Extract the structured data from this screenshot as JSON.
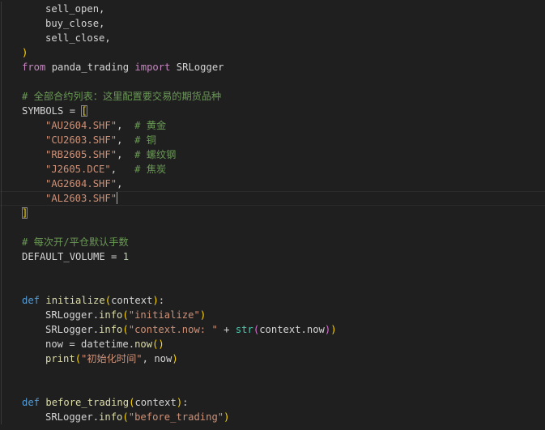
{
  "editor": {
    "language": "python",
    "lines": [
      {
        "indent": 1,
        "tokens": [
          {
            "t": "sell_open,",
            "c": "id"
          }
        ]
      },
      {
        "indent": 1,
        "tokens": [
          {
            "t": "buy_close,",
            "c": "id"
          }
        ]
      },
      {
        "indent": 1,
        "tokens": [
          {
            "t": "sell_close,",
            "c": "id"
          }
        ]
      },
      {
        "indent": 0,
        "tokens": [
          {
            "t": ")",
            "c": "br1"
          }
        ]
      },
      {
        "indent": 0,
        "tokens": [
          {
            "t": "from",
            "c": "imp"
          },
          {
            "t": " panda_trading ",
            "c": "id"
          },
          {
            "t": "import",
            "c": "imp"
          },
          {
            "t": " SRLogger",
            "c": "id"
          }
        ]
      },
      {
        "indent": 0,
        "tokens": []
      },
      {
        "indent": 0,
        "tokens": [
          {
            "t": "# 全部合约列表：这里配置要交易的期货品种",
            "c": "cm"
          }
        ]
      },
      {
        "indent": 0,
        "tokens": [
          {
            "t": "SYMBOLS = ",
            "c": "id"
          },
          {
            "t": "[",
            "c": "br1",
            "match": true
          }
        ]
      },
      {
        "indent": 1,
        "tokens": [
          {
            "t": "\"AU2604.SHF\"",
            "c": "str"
          },
          {
            "t": ",  ",
            "c": "op"
          },
          {
            "t": "# 黄金",
            "c": "cm"
          }
        ]
      },
      {
        "indent": 1,
        "tokens": [
          {
            "t": "\"CU2603.SHF\"",
            "c": "str"
          },
          {
            "t": ",  ",
            "c": "op"
          },
          {
            "t": "# 铜",
            "c": "cm"
          }
        ]
      },
      {
        "indent": 1,
        "tokens": [
          {
            "t": "\"RB2605.SHF\"",
            "c": "str"
          },
          {
            "t": ",  ",
            "c": "op"
          },
          {
            "t": "# 螺纹钢",
            "c": "cm"
          }
        ]
      },
      {
        "indent": 1,
        "tokens": [
          {
            "t": "\"J2605.DCE\"",
            "c": "str"
          },
          {
            "t": ",   ",
            "c": "op"
          },
          {
            "t": "# 焦炭",
            "c": "cm"
          }
        ]
      },
      {
        "indent": 1,
        "tokens": [
          {
            "t": "\"AG2604.SHF\"",
            "c": "str"
          },
          {
            "t": ",",
            "c": "op"
          }
        ]
      },
      {
        "indent": 1,
        "tokens": [
          {
            "t": "\"AL2603.SHF\"",
            "c": "str"
          }
        ],
        "cursor": true
      },
      {
        "indent": 0,
        "tokens": [
          {
            "t": "]",
            "c": "br1",
            "match": true
          }
        ]
      },
      {
        "indent": 0,
        "tokens": []
      },
      {
        "indent": 0,
        "tokens": [
          {
            "t": "# 每次开/平仓默认手数",
            "c": "cm"
          }
        ]
      },
      {
        "indent": 0,
        "tokens": [
          {
            "t": "DEFAULT_VOLUME = ",
            "c": "id"
          },
          {
            "t": "1",
            "c": "num"
          }
        ]
      },
      {
        "indent": 0,
        "tokens": []
      },
      {
        "indent": 0,
        "tokens": []
      },
      {
        "indent": 0,
        "tokens": [
          {
            "t": "def",
            "c": "kw"
          },
          {
            "t": " ",
            "c": "id"
          },
          {
            "t": "initialize",
            "c": "fn"
          },
          {
            "t": "(",
            "c": "br1"
          },
          {
            "t": "context",
            "c": "id"
          },
          {
            "t": ")",
            "c": "br1"
          },
          {
            "t": ":",
            "c": "op"
          }
        ]
      },
      {
        "indent": 1,
        "tokens": [
          {
            "t": "SRLogger.",
            "c": "id"
          },
          {
            "t": "info",
            "c": "fn"
          },
          {
            "t": "(",
            "c": "br1"
          },
          {
            "t": "\"initialize\"",
            "c": "str"
          },
          {
            "t": ")",
            "c": "br1"
          }
        ]
      },
      {
        "indent": 1,
        "tokens": [
          {
            "t": "SRLogger.",
            "c": "id"
          },
          {
            "t": "info",
            "c": "fn"
          },
          {
            "t": "(",
            "c": "br1"
          },
          {
            "t": "\"context.now: \"",
            "c": "str"
          },
          {
            "t": " + ",
            "c": "op"
          },
          {
            "t": "str",
            "c": "bi"
          },
          {
            "t": "(",
            "c": "br2"
          },
          {
            "t": "context.now",
            "c": "id"
          },
          {
            "t": ")",
            "c": "br2"
          },
          {
            "t": ")",
            "c": "br1"
          }
        ]
      },
      {
        "indent": 1,
        "tokens": [
          {
            "t": "now = datetime.",
            "c": "id"
          },
          {
            "t": "now",
            "c": "fn"
          },
          {
            "t": "()",
            "c": "br1"
          }
        ]
      },
      {
        "indent": 1,
        "tokens": [
          {
            "t": "print",
            "c": "fn"
          },
          {
            "t": "(",
            "c": "br1"
          },
          {
            "t": "\"初始化时间\"",
            "c": "str"
          },
          {
            "t": ", now",
            "c": "id"
          },
          {
            "t": ")",
            "c": "br1"
          }
        ]
      },
      {
        "indent": 0,
        "tokens": []
      },
      {
        "indent": 0,
        "tokens": []
      },
      {
        "indent": 0,
        "tokens": [
          {
            "t": "def",
            "c": "kw"
          },
          {
            "t": " ",
            "c": "id"
          },
          {
            "t": "before_trading",
            "c": "fn"
          },
          {
            "t": "(",
            "c": "br1"
          },
          {
            "t": "context",
            "c": "id"
          },
          {
            "t": ")",
            "c": "br1"
          },
          {
            "t": ":",
            "c": "op"
          }
        ]
      },
      {
        "indent": 1,
        "tokens": [
          {
            "t": "SRLogger.",
            "c": "id"
          },
          {
            "t": "info",
            "c": "fn"
          },
          {
            "t": "(",
            "c": "br1"
          },
          {
            "t": "\"before_trading\"",
            "c": "str"
          },
          {
            "t": ")",
            "c": "br1"
          }
        ]
      }
    ]
  }
}
